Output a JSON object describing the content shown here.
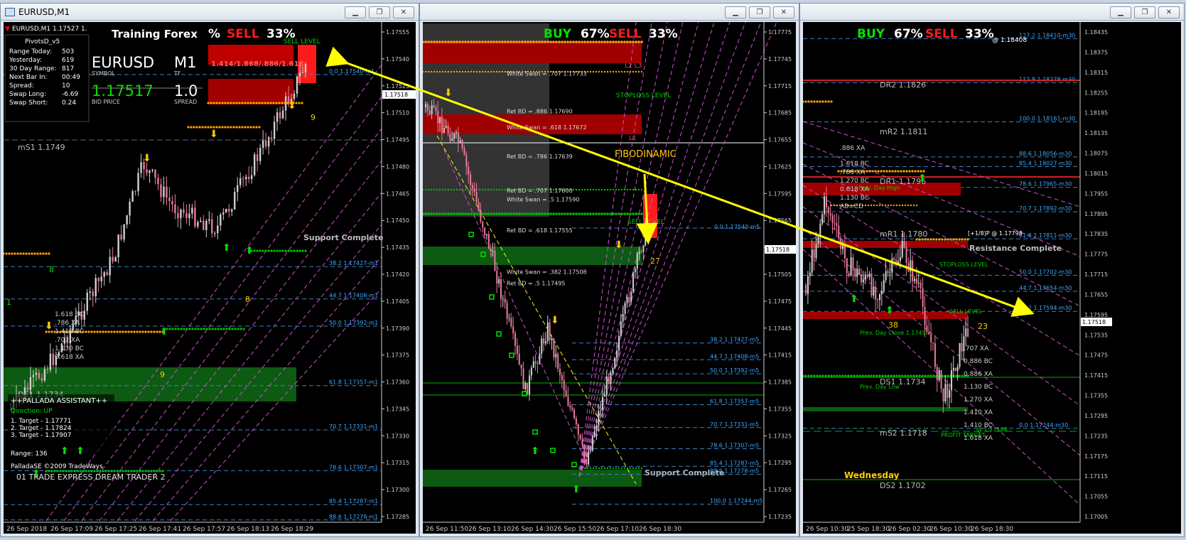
{
  "colors": {
    "bull": "#d0d0d0",
    "bear": "#e87a9a",
    "accent_yellow": "#ffff00",
    "buy_green": "#00e400",
    "sell_red": "#ff1a1a",
    "level_blue": "#3fa8ff",
    "fib_magenta": "#d050d0",
    "orange": "#ffa500"
  },
  "icons": [
    "window-icon",
    "minimize-icon",
    "restore-icon",
    "close-icon"
  ],
  "windows": [
    {
      "title": "EURUSD,M1",
      "symbol_line": "EURUSD,M1  1.17527 1.",
      "training_title": "Training Forex",
      "buy_sell": {
        "buy_pct": "%",
        "sell_label": "SELL",
        "sell_pct": "33%"
      },
      "pivots": {
        "header": "PivotsD_v5",
        "rows": [
          {
            "label": "Range  Today:",
            "value": "503"
          },
          {
            "label": "Yesterday:",
            "value": "619"
          },
          {
            "label": "30 Day Range:",
            "value": "817"
          },
          {
            "label": "Next Bar In:",
            "value": "00:49"
          },
          {
            "label": "Spread:",
            "value": "10"
          },
          {
            "label": "Swap  Long:",
            "value": "-6.69"
          },
          {
            "label": "Swap  Short:",
            "value": "0.24"
          }
        ]
      },
      "quote": {
        "symbol": "EURUSD",
        "symbol_caption": "SYMBOL",
        "tf": "M1",
        "tf_caption": "TF",
        "bid": "1.17517",
        "bid_caption": "BID PRICE",
        "spread": "1.0",
        "spread_caption": "SPREAD"
      },
      "ms1": "mS1  1.1749",
      "ds1": "DS1  1.1734",
      "sell_level": "SELL LEVEL",
      "fib_box_text": "1.414/1.868/.886/1.618",
      "support_complete": "Support Complete",
      "assistant": {
        "title": "++PALLADA ASSISTANT++",
        "direction": "Direction: UP",
        "targets": [
          "1. Target - 1.17771",
          "2. Target - 1.17824",
          "3. Target - 1.17907"
        ],
        "range": "Range: 136",
        "copyright": "PalladaSE ©2009 TradeWays",
        "brand": "01 TRADE EXPRESS DREAM TRADER 2"
      },
      "markers": [
        "9",
        "8",
        "9",
        "1",
        "8"
      ],
      "harmonics": [
        "1.618 BC",
        ".786 XA",
        "1.410 BC",
        ".707 XA",
        "1.130 BC",
        "0.618 XA"
      ],
      "levels": [
        {
          "label": "0.0   1.17540-m1",
          "price": 1.1754
        },
        {
          "label": "38.2   1.17427-m1",
          "price": 1.17427
        },
        {
          "label": "44.7   1.17408-m1",
          "price": 1.17408
        },
        {
          "label": "50.0   1.17392-m1",
          "price": 1.17392
        },
        {
          "label": "61.8   1.17357-m1",
          "price": 1.17357
        },
        {
          "label": "70.7   1.17331-m1",
          "price": 1.17331
        },
        {
          "label": "78.6   1.17307-m1",
          "price": 1.17307
        },
        {
          "label": "85.4   1.17287-m1",
          "price": 1.17287
        },
        {
          "label": "88.6   1.17278-m1",
          "price": 1.17278
        }
      ],
      "axis": {
        "min": 1.1728,
        "max": 1.17565,
        "ticks": [
          "1.17555",
          "1.17540",
          "1.17525",
          "1.17510",
          "1.17495",
          "1.17480",
          "1.17465",
          "1.17450",
          "1.17435",
          "1.17420",
          "1.17405",
          "1.17390",
          "1.17375",
          "1.17360",
          "1.17345",
          "1.17330",
          "1.17315",
          "1.17300",
          "1.17285"
        ],
        "current": "1.17518"
      },
      "time_labels": [
        "26 Sep 2018",
        "26 Sep 17:09",
        "26 Sep 17:25",
        "26 Sep 17:41",
        "26 Sep 17:57",
        "26 Sep 18:13",
        "26 Sep 18:29"
      ]
    },
    {
      "title": "",
      "buy_sell": {
        "buy_label": "BUY",
        "buy_pct": "67%",
        "sell_label": "SELL",
        "sell_pct": "33%"
      },
      "swan_labels": [
        {
          "text": "White Swan = .707  1.17733",
          "price": 1.17733
        },
        {
          "text": "Ret BD = .886  1.17690",
          "price": 1.1769
        },
        {
          "text": "White Swan = .618  1.17672",
          "price": 1.17672
        },
        {
          "text": "Ret BD = .786  1.17639",
          "price": 1.17639
        },
        {
          "text": "Ret BD = .707  1.17600",
          "price": 1.176
        },
        {
          "text": "White Swan = .5  1.17590",
          "price": 1.1759
        },
        {
          "text": "Ret BD = .618  1.17555",
          "price": 1.17555
        },
        {
          "text": "White Swan = .382  1.17508",
          "price": 1.17508
        },
        {
          "text": "Ret BD = .5  1.17495",
          "price": 1.17495
        }
      ],
      "stoploss": "STOPLOSS LEVEL",
      "sell_level": "SELL LEVEL",
      "l_marks": [
        "L2 L3",
        "L1",
        "L1 L2"
      ],
      "fibodinamic": "FIBODINAMIC",
      "support_complete": "Support Complete",
      "markers": [
        "27"
      ],
      "fib_zero": "0.0   1.17540-m5",
      "levels": [
        {
          "label": "38.2   1.17427-m5",
          "price": 1.17427
        },
        {
          "label": "44.7   1.17408-m5",
          "price": 1.17408
        },
        {
          "label": "50.0   1.17392-m5",
          "price": 1.17392
        },
        {
          "label": "61.8   1.17357-m5",
          "price": 1.17357
        },
        {
          "label": "70.7   1.17331-m5",
          "price": 1.17331
        },
        {
          "label": "78.6   1.17307-m5",
          "price": 1.17307
        },
        {
          "label": "85.4   1.17287-m5",
          "price": 1.17287
        },
        {
          "label": "88.6   1.17278-m5",
          "price": 1.17278
        },
        {
          "label": "100.0   1.17244-m5",
          "price": 1.17244
        }
      ],
      "axis": {
        "min": 1.1723,
        "max": 1.1778,
        "ticks": [
          "1.17775",
          "1.17745",
          "1.17715",
          "1.17685",
          "1.17655",
          "1.17625",
          "1.17595",
          "1.17565",
          "1.17535",
          "1.17505",
          "1.17475",
          "1.17445",
          "1.17415",
          "1.17385",
          "1.17355",
          "1.17325",
          "1.17295",
          "1.17265",
          "1.17235"
        ],
        "current": "1.17518"
      },
      "time_labels": [
        "26 Sep 11:50",
        "26 Sep 13:10",
        "26 Sep 14:30",
        "26 Sep 15:50",
        "26 Sep 17:10",
        "26 Sep 18:30"
      ]
    },
    {
      "title": "",
      "buy_sell": {
        "buy_label": "BUY",
        "buy_pct": "67%",
        "sell_label": "SELL",
        "sell_pct": "33%"
      },
      "tp_top": "@ 1.18408",
      "pivots": [
        {
          "text": "DR2  1.1826"
        },
        {
          "text": "mR2  1.1811"
        },
        {
          "text": "DR1  1.1796"
        },
        {
          "text": "mR1  1.1780"
        },
        {
          "text": "DS1  1.1734"
        },
        {
          "text": "mS2  1.1718"
        },
        {
          "text": "DS2  1.1702"
        }
      ],
      "prev_high": "Prev. Day High",
      "prev_close": "Prev. Day Close 1.1749",
      "prev_low": "Prev. Day Low",
      "resistance": "Resistance Complete",
      "stoploss": "STOPLOSS LEVEL",
      "sell_level": "SELL LEVEL",
      "profit_target": "PROFIT TARGET",
      "tp_mid": "[+1/8]P @ 1.17798",
      "tp_low": "@ 1.17188",
      "weekday": "Wednesday",
      "markers": [
        "38",
        "23"
      ],
      "harmonics_left": [
        ".886 XA",
        "1.618 BC",
        ".786 XA",
        "1.270 BC",
        "0.618 XA",
        "1.130 BC",
        "AB=CD"
      ],
      "harmonics_right": [
        ".707 XA",
        "0.886 BC",
        "0.886 XA",
        "1.130 BC",
        "1.270 XA",
        "1.410 XA",
        "1.410 BC",
        "1.618 XA"
      ],
      "levels": [
        {
          "label": "127.2   1.18410-m30",
          "price": 1.1841
        },
        {
          "label": "112.8   1.18278-m30",
          "price": 1.18278
        },
        {
          "label": "100.0   1.18161-m30",
          "price": 1.18161
        },
        {
          "label": "88.6   1.18056-m30",
          "price": 1.18056
        },
        {
          "label": "85.4   1.18027-m30",
          "price": 1.18027
        },
        {
          "label": "78.6   1.17965-m30",
          "price": 1.17965
        },
        {
          "label": "70.7   1.17892-m30",
          "price": 1.17892
        },
        {
          "label": "61.8   1.17811-m30",
          "price": 1.17811
        },
        {
          "label": "50.0   1.17702-m30",
          "price": 1.17702
        },
        {
          "label": "44.7   1.17654-m30",
          "price": 1.17654
        },
        {
          "label": "38.2   1.17594-m30",
          "price": 1.17594
        },
        {
          "label": "0.0   1.17244-m30",
          "price": 1.17244
        }
      ],
      "axis": {
        "min": 1.1698,
        "max": 1.1843,
        "ticks": [
          "1.18435",
          "1.18405",
          "1.18375",
          "1.18345",
          "1.18315",
          "1.18285",
          "1.18255",
          "1.18225",
          "1.18195",
          "1.18165",
          "1.18135",
          "1.18105",
          "1.18075",
          "1.18045",
          "1.18015",
          "1.17985",
          "1.17955",
          "1.17925",
          "1.17895",
          "1.17865",
          "1.17835",
          "1.17805",
          "1.17775",
          "1.17745",
          "1.17715",
          "1.17685",
          "1.17655",
          "1.17625",
          "1.17595",
          "1.17565",
          "1.17535",
          "1.17505",
          "1.17475",
          "1.17445",
          "1.17415",
          "1.17385",
          "1.17355",
          "1.17325",
          "1.17295",
          "1.17265",
          "1.17235",
          "1.17205",
          "1.17175",
          "1.17145",
          "1.17115",
          "1.17085",
          "1.17055",
          "1.17025",
          "1.17005"
        ],
        "current": "1.17518"
      },
      "time_labels": [
        "26 Sep 10:30",
        "25 Sep 18:30",
        "26 Sep 02:30",
        "26 Sep 10:30",
        "26 Sep 18:30"
      ]
    }
  ]
}
